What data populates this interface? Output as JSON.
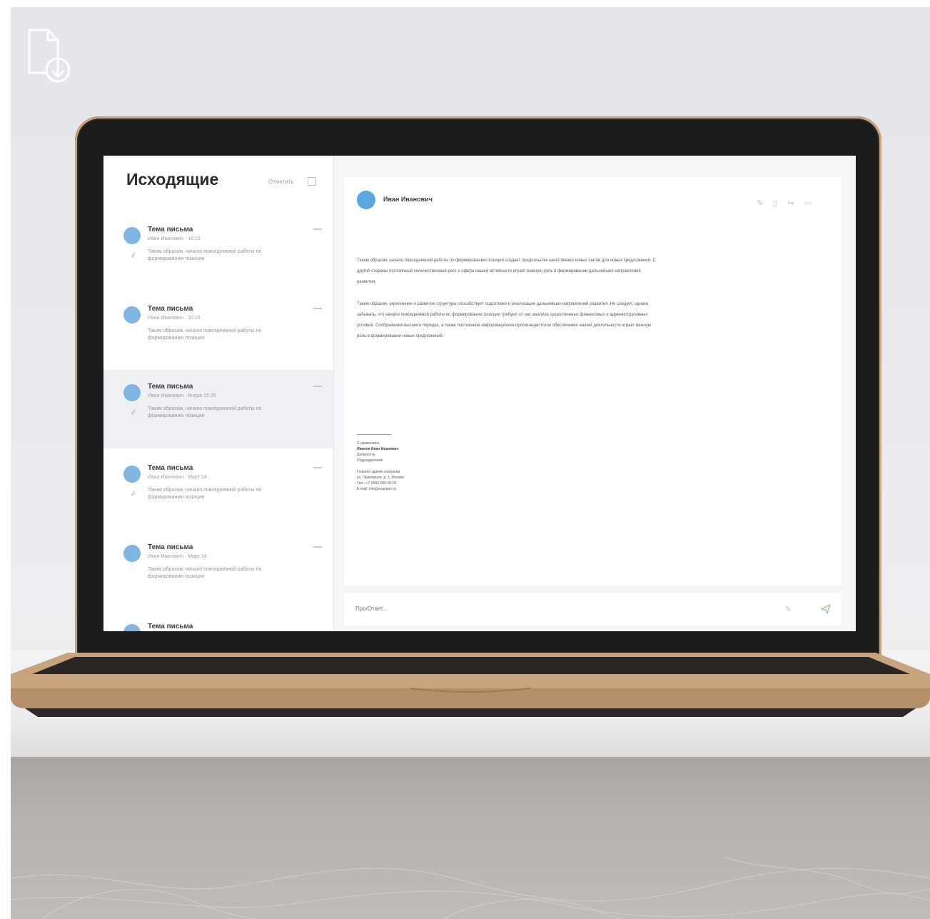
{
  "sidebar": {
    "title": "Исходящие",
    "action_label": "Отметить"
  },
  "mails": [
    {
      "subject": "Тема письма",
      "meta": "Иван Иванович · 10:15",
      "preview": "Таким образом, начало повседневной работы по формированию позиции",
      "attachment": true,
      "selected": false
    },
    {
      "subject": "Тема письма",
      "meta": "Иван Иванович · 10:15",
      "preview": "Таким образом, начало повседневной работы по формированию позиции",
      "attachment": false,
      "selected": false
    },
    {
      "subject": "Тема письма",
      "meta": "Иван Иванович · Вчера 15:25",
      "preview": "Таким образом, начало повседневной работы по формированию позиции",
      "attachment": true,
      "selected": true
    },
    {
      "subject": "Тема письма",
      "meta": "Иван Иванович · Март 14",
      "preview": "Таким образом, начало повседневной работы по формированию позиции",
      "attachment": true,
      "selected": false
    },
    {
      "subject": "Тема письма",
      "meta": "Иван Иванович · Март 14",
      "preview": "Таким образом, начало повседневной работы по формированию позиции",
      "attachment": false,
      "selected": false
    },
    {
      "subject": "Тема письма",
      "meta": "",
      "preview": "",
      "attachment": false,
      "selected": false
    }
  ],
  "reader": {
    "sender": "Иван Иванович",
    "body": [
      "Таким образом, начало повседневной работы по формированию позиции создает предпосылки качественно новых шагов для новых предложений. С другой стороны постоянный количественный рост и сфера нашей активности играет важную роль в формировании дальнейших направлений развития.",
      "Таким образом, укрепление и развитие структуры способствует подготовке и реализации дальнейших направлений развития. Не следует, однако забывать, что начало повседневной работы по формированию позиции требуют от нас анализа существенных финансовых и административных условий. Соображения высшего порядка, а также постоянное информационно-пропагандистское обеспечение нашей деятельности играет важную роль в формировании новых предложений."
    ],
    "signature": [
      "С уважением,",
      "Иванов Иван Иванович",
      "Должность",
      "Подразделение",
      "",
      "Главное здание компании",
      "ул. Примерная, д. 1, Москва",
      "Тел.: +7 (000) 000-00-00",
      "E-mail: info@example.ru"
    ]
  },
  "reply": {
    "placeholder": "Про/Ответ..."
  },
  "colors": {
    "accent": "#5aa6df",
    "lid": "#1b1b1c",
    "gold": "#c9a27a"
  },
  "icons": [
    "file-download-icon",
    "attachment-icon",
    "more-icon",
    "edit-icon",
    "delete-icon",
    "forward-icon",
    "send-icon"
  ]
}
